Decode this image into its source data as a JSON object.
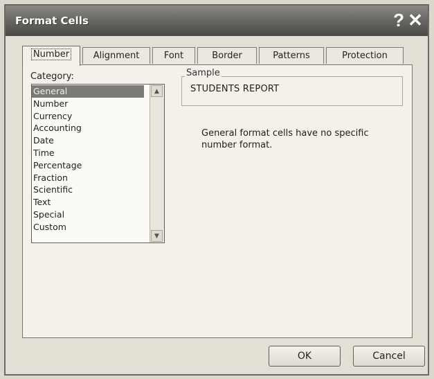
{
  "window": {
    "title": "Format Cells",
    "help_glyph": "?",
    "close_glyph": "✕"
  },
  "tabs": [
    {
      "label": "Number",
      "active": true
    },
    {
      "label": "Alignment",
      "active": false
    },
    {
      "label": "Font",
      "active": false
    },
    {
      "label": "Border",
      "active": false
    },
    {
      "label": "Patterns",
      "active": false
    },
    {
      "label": "Protection",
      "active": false
    }
  ],
  "category": {
    "label": "Category:",
    "items": [
      "General",
      "Number",
      "Currency",
      "Accounting",
      "Date",
      "Time",
      "Percentage",
      "Fraction",
      "Scientific",
      "Text",
      "Special",
      "Custom"
    ],
    "selected": "General",
    "scroll_up_glyph": "▲",
    "scroll_down_glyph": "▼"
  },
  "sample": {
    "label": "Sample",
    "value": "STUDENTS REPORT"
  },
  "description": "General format cells have no specific number format.",
  "buttons": {
    "ok": "OK",
    "cancel": "Cancel"
  }
}
